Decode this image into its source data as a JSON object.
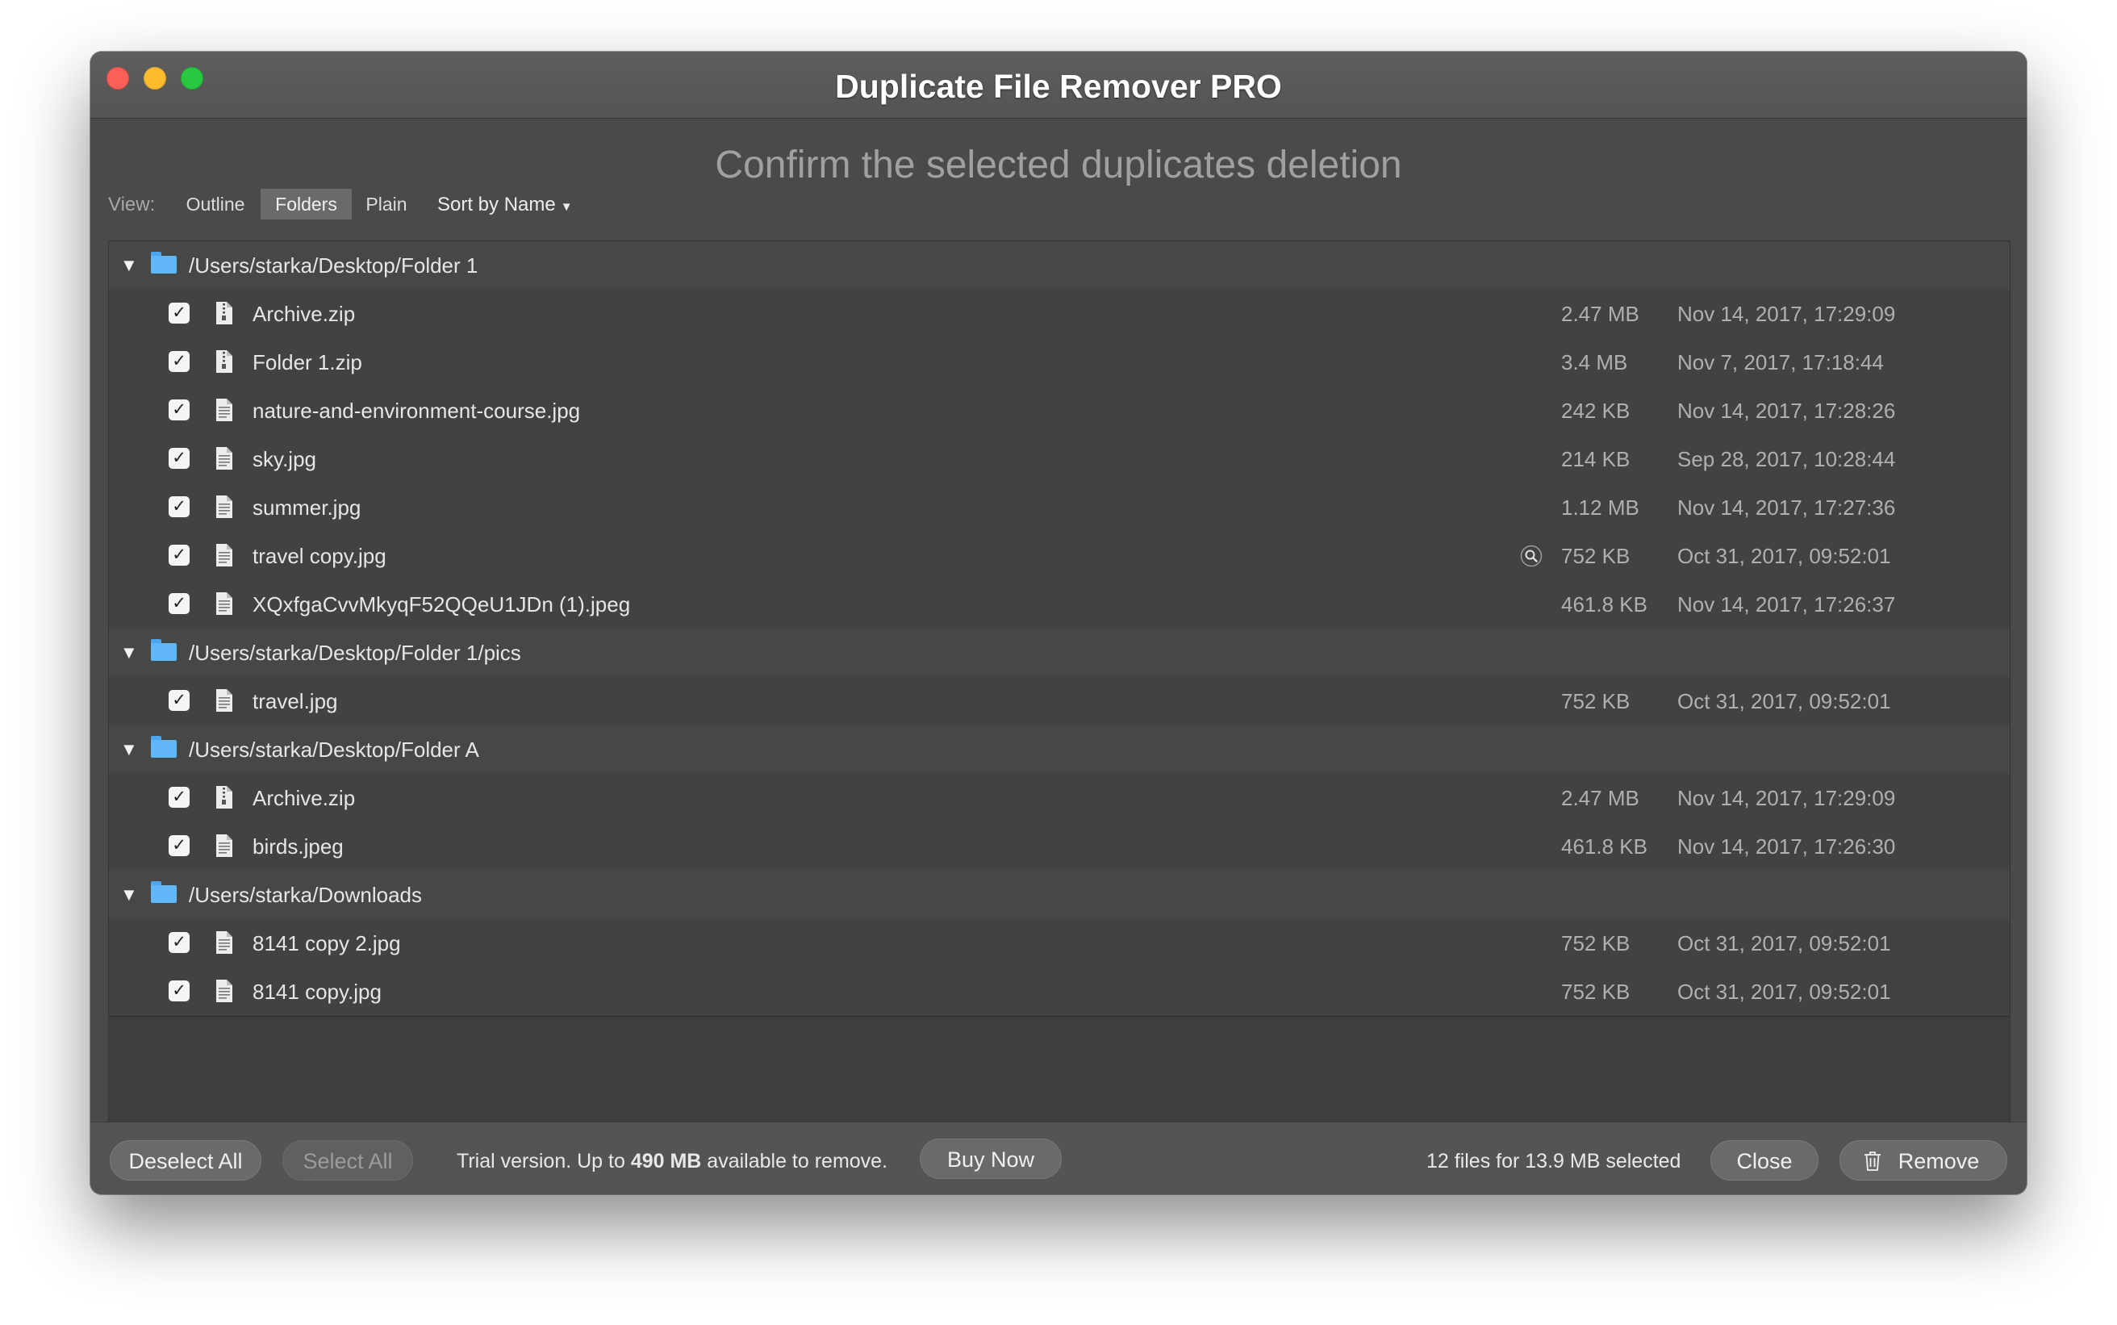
{
  "window": {
    "title": "Duplicate File Remover PRO"
  },
  "subtitle": "Confirm the selected duplicates deletion",
  "toolbar": {
    "view_label": "View:",
    "view_modes": [
      "Outline",
      "Folders",
      "Plain"
    ],
    "selected_view": "Folders",
    "sort_label": "Sort by Name"
  },
  "groups": [
    {
      "path": "/Users/starka/Desktop/Folder 1",
      "files": [
        {
          "name": "Archive.zip",
          "size": "2.47 MB",
          "date": "Nov 14, 2017, 17:29:09",
          "checked": true,
          "icon": "zip-file-icon"
        },
        {
          "name": "Folder 1.zip",
          "size": "3.4 MB",
          "date": "Nov 7, 2017, 17:18:44",
          "checked": true,
          "icon": "zip-file-icon"
        },
        {
          "name": "nature-and-environment-course.jpg",
          "size": "242 KB",
          "date": "Nov 14, 2017, 17:28:26",
          "checked": true,
          "icon": "image-file-icon"
        },
        {
          "name": "sky.jpg",
          "size": "214 KB",
          "date": "Sep 28, 2017, 10:28:44",
          "checked": true,
          "icon": "image-file-icon"
        },
        {
          "name": "summer.jpg",
          "size": "1.12 MB",
          "date": "Nov 14, 2017, 17:27:36",
          "checked": true,
          "icon": "image-file-icon"
        },
        {
          "name": "travel copy.jpg",
          "size": "752 KB",
          "date": "Oct 31, 2017, 09:52:01",
          "checked": true,
          "icon": "image-file-icon",
          "quicklook": true
        },
        {
          "name": "XQxfgaCvvMkyqF52QQeU1JDn (1).jpeg",
          "size": "461.8 KB",
          "date": "Nov 14, 2017, 17:26:37",
          "checked": true,
          "icon": "image-file-icon"
        }
      ]
    },
    {
      "path": "/Users/starka/Desktop/Folder 1/pics",
      "files": [
        {
          "name": "travel.jpg",
          "size": "752 KB",
          "date": "Oct 31, 2017, 09:52:01",
          "checked": true,
          "icon": "image-file-icon"
        }
      ]
    },
    {
      "path": "/Users/starka/Desktop/Folder A",
      "files": [
        {
          "name": "Archive.zip",
          "size": "2.47 MB",
          "date": "Nov 14, 2017, 17:29:09",
          "checked": true,
          "icon": "zip-file-icon"
        },
        {
          "name": "birds.jpeg",
          "size": "461.8 KB",
          "date": "Nov 14, 2017, 17:26:30",
          "checked": true,
          "icon": "image-file-icon"
        }
      ]
    },
    {
      "path": "/Users/starka/Downloads",
      "files": [
        {
          "name": "8141 copy 2.jpg",
          "size": "752 KB",
          "date": "Oct 31, 2017, 09:52:01",
          "checked": true,
          "icon": "image-file-icon"
        },
        {
          "name": "8141 copy.jpg",
          "size": "752 KB",
          "date": "Oct 31, 2017, 09:52:01",
          "checked": true,
          "icon": "image-file-icon"
        }
      ]
    }
  ],
  "footer": {
    "deselect_all": "Deselect All",
    "select_all": "Select All",
    "trial_prefix": "Trial version. Up to ",
    "trial_amount": "490 MB",
    "trial_suffix": " available to remove.",
    "buy_now": "Buy Now",
    "selected_info": "12 files for 13.9 MB selected",
    "close": "Close",
    "remove": "Remove"
  },
  "colors": {
    "window_bg": "#4a4a4a",
    "folder_icon": "#60b6f6",
    "close_light": "#fc5f57",
    "minimize_light": "#fdbc2e",
    "zoom_light": "#29c840"
  }
}
